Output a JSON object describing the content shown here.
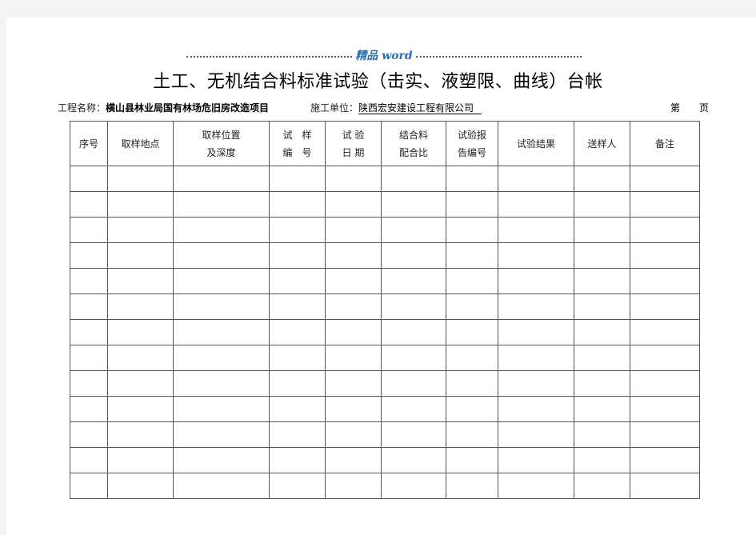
{
  "watermark": "精品 word",
  "title": "土工、无机结合料标准试验（击实、液塑限、曲线）台帐",
  "info": {
    "project_label": "工程名称：",
    "project_value": "横山县林业局国有林场危旧房改造项目",
    "contractor_label": "施工单位：",
    "contractor_value": "陕西宏安建设工程有限公司",
    "page_label_1": "第",
    "page_label_2": "页"
  },
  "table": {
    "headers": [
      {
        "line1": "序号",
        "line2": ""
      },
      {
        "line1": "取样地点",
        "line2": ""
      },
      {
        "line1": "取样位置",
        "line2": "及深度"
      },
      {
        "line1": "试　样",
        "line2": "编　号"
      },
      {
        "line1": "试 验",
        "line2": "日 期"
      },
      {
        "line1": "结合料",
        "line2": "配合比"
      },
      {
        "line1": "试验报",
        "line2": "告编号"
      },
      {
        "line1": "试验结果",
        "line2": ""
      },
      {
        "line1": "送样人",
        "line2": ""
      },
      {
        "line1": "备注",
        "line2": ""
      }
    ],
    "row_count": 13
  }
}
